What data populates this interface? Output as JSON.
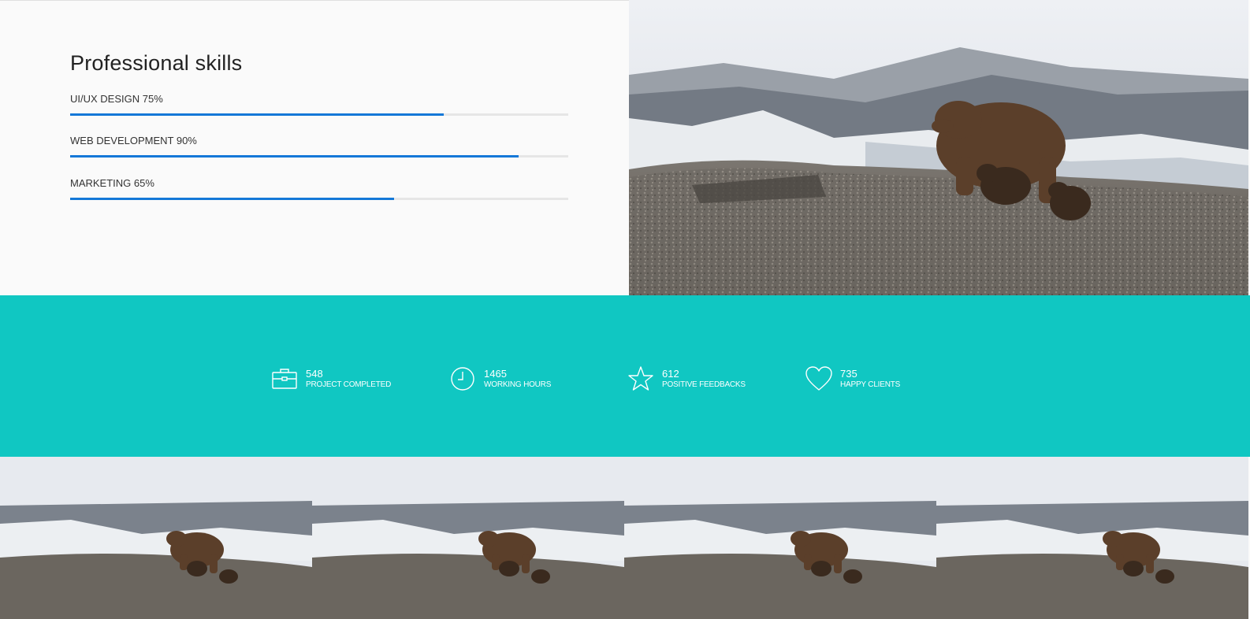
{
  "skills": {
    "title": "Professional skills",
    "items": [
      {
        "label": "UI/UX DESIGN 75%",
        "percent": 75
      },
      {
        "label": "WEB DEVELOPMENT 90%",
        "percent": 90
      },
      {
        "label": "MARKETING 65%",
        "percent": 65
      }
    ]
  },
  "stats": [
    {
      "number": "548",
      "label": "PROJECT COMPLETED",
      "icon": "briefcase-icon"
    },
    {
      "number": "1465",
      "label": "WORKING HOURS",
      "icon": "clock-icon"
    },
    {
      "number": "612",
      "label": "POSITIVE FEEDBACKS",
      "icon": "star-icon"
    },
    {
      "number": "735",
      "label": "HAPPY CLIENTS",
      "icon": "heart-icon"
    }
  ],
  "colors": {
    "accent_blue": "#1478d8",
    "band_teal": "#10c7c2"
  }
}
